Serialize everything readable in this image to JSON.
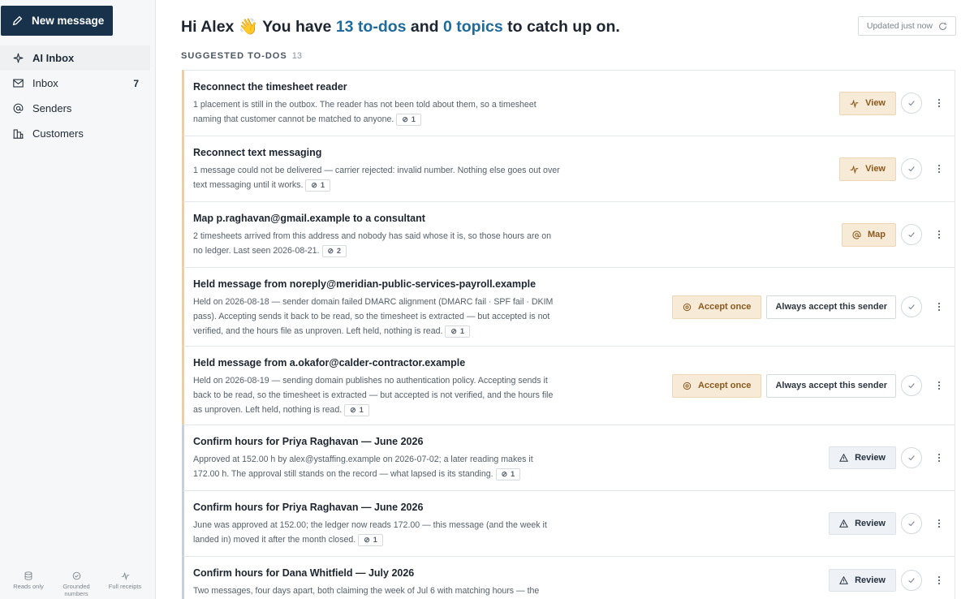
{
  "sidebar": {
    "new_message": "New message",
    "items": [
      {
        "label": "AI Inbox",
        "icon": "sparkle-icon",
        "count": ""
      },
      {
        "label": "Inbox",
        "icon": "mail-icon",
        "count": "7"
      },
      {
        "label": "Senders",
        "icon": "at-icon",
        "count": ""
      },
      {
        "label": "Customers",
        "icon": "building-icon",
        "count": ""
      }
    ],
    "footer": [
      {
        "label": "Reads only",
        "icon": "database-icon"
      },
      {
        "label": "Grounded numbers",
        "icon": "check-circle-icon"
      },
      {
        "label": "Full receipts",
        "icon": "pulse-icon"
      }
    ]
  },
  "header": {
    "greet_prefix": "Hi Alex 👋 You have ",
    "todos_count": "13 to-dos",
    "middle": " and ",
    "topics_count": "0 topics",
    "suffix": " to catch up on.",
    "updated": "Updated just now"
  },
  "section": {
    "label": "SUGGESTED TO-DOS",
    "count": "13"
  },
  "colors": {
    "primary": "#17324a",
    "accent_link": "#1e6b9c",
    "warm_bg": "#f7ead6",
    "warm_text": "#8a5a1e"
  },
  "todos": [
    {
      "title": "Reconnect the timesheet reader",
      "body": "1 placement is still in the outbox. The reader has not been told about them, so a timesheet naming that customer cannot be matched to anyone.",
      "chip": "1",
      "actions": [
        {
          "kind": "warm",
          "label": "View",
          "icon": "pulse-icon"
        }
      ]
    },
    {
      "title": "Reconnect text messaging",
      "body": "1 message could not be delivered — carrier rejected: invalid number. Nothing else goes out over text messaging until it works.",
      "chip": "1",
      "actions": [
        {
          "kind": "warm",
          "label": "View",
          "icon": "pulse-icon"
        }
      ]
    },
    {
      "title": "Map p.raghavan@gmail.example to a consultant",
      "body": "2 timesheets arrived from this address and nobody has said whose it is, so those hours are on no ledger. Last seen 2026-08-21.",
      "chip": "2",
      "actions": [
        {
          "kind": "warm",
          "label": "Map",
          "icon": "at-icon"
        }
      ]
    },
    {
      "title": "Held message from noreply@meridian-public-services-payroll.example",
      "body": "Held on 2026-08-18 — sender domain failed DMARC alignment (DMARC fail · SPF fail · DKIM pass). Accepting sends it back to be read, so the timesheet is extracted — but accepted is not verified, and the hours file as unproven. Left held, nothing is read.",
      "chip": "1",
      "actions": [
        {
          "kind": "warm",
          "label": "Accept once",
          "icon": "shield-icon"
        },
        {
          "kind": "outline",
          "label": "Always accept this sender",
          "icon": ""
        }
      ]
    },
    {
      "title": "Held message from a.okafor@calder-contractor.example",
      "body": "Held on 2026-08-19 — sending domain publishes no authentication policy. Accepting sends it back to be read, so the timesheet is extracted — but accepted is not verified, and the hours file as unproven. Left held, nothing is read.",
      "chip": "1",
      "actions": [
        {
          "kind": "warm",
          "label": "Accept once",
          "icon": "shield-icon"
        },
        {
          "kind": "outline",
          "label": "Always accept this sender",
          "icon": ""
        }
      ]
    },
    {
      "title": "Confirm hours for Priya Raghavan — June 2026",
      "body": "Approved at 152.00 h by alex@ystaffing.example on 2026-07-02; a later reading makes it 172.00 h. The approval still stands on the record — what lapsed is its standing.",
      "chip": "1",
      "actions": [
        {
          "kind": "review",
          "label": "Review",
          "icon": "warning-icon"
        }
      ]
    },
    {
      "title": "Confirm hours for Priya Raghavan — June 2026",
      "body": "June was approved at 152.00; the ledger now reads 172.00 — this message (and the week it landed in) moved it after the month closed.",
      "chip": "1",
      "actions": [
        {
          "kind": "review",
          "label": "Review",
          "icon": "warning-icon"
        }
      ]
    },
    {
      "title": "Confirm hours for Dana Whitfield — July 2026",
      "body": "Two messages, four days apart, both claiming the week of Jul 6 with matching hours — the",
      "chip": "",
      "actions": [
        {
          "kind": "review",
          "label": "Review",
          "icon": "warning-icon"
        }
      ]
    }
  ]
}
